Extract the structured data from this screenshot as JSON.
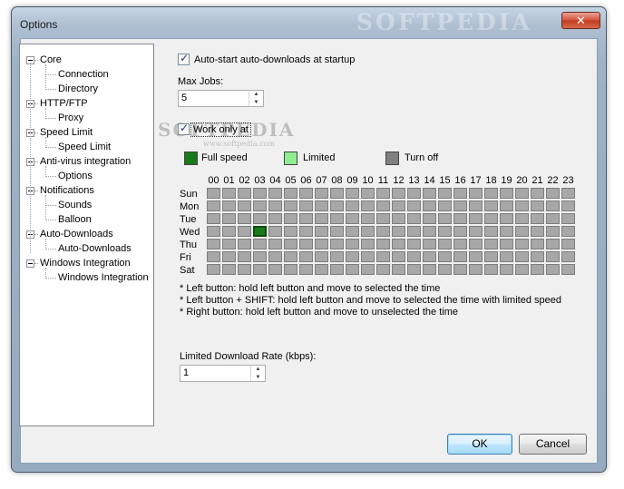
{
  "window": {
    "title": "Options",
    "close_glyph": "✕",
    "watermark": "SOFTPEDIA",
    "faint_watermark": "SOFTPEDIA",
    "faint_watermark_sub": "www.softpedia.com"
  },
  "tree": {
    "groups": [
      {
        "label": "Core",
        "children": [
          "Connection",
          "Directory"
        ]
      },
      {
        "label": "HTTP/FTP",
        "children": [
          "Proxy"
        ]
      },
      {
        "label": "Speed Limit",
        "children": [
          "Speed Limit"
        ]
      },
      {
        "label": "Anti-virus integration",
        "children": [
          "Options"
        ]
      },
      {
        "label": "Notifications",
        "children": [
          "Sounds",
          "Balloon"
        ]
      },
      {
        "label": "Auto-Downloads",
        "children": [
          "Auto-Downloads"
        ]
      },
      {
        "label": "Windows Integration",
        "children": [
          "Windows Integration"
        ]
      }
    ]
  },
  "settings": {
    "auto_start_label": "Auto-start auto-downloads at startup",
    "auto_start_checked": true,
    "max_jobs_label": "Max Jobs:",
    "max_jobs_value": "5",
    "work_only_label": "Work only at",
    "work_only_checked": true
  },
  "legend": {
    "full": {
      "label": "Full speed",
      "color": "#1a7a1a"
    },
    "limited": {
      "label": "Limited",
      "color": "#90ee90"
    },
    "off": {
      "label": "Turn off",
      "color": "#808080"
    }
  },
  "schedule": {
    "hours": [
      "00",
      "01",
      "02",
      "03",
      "04",
      "05",
      "06",
      "07",
      "08",
      "09",
      "10",
      "11",
      "12",
      "13",
      "14",
      "15",
      "16",
      "17",
      "18",
      "19",
      "20",
      "21",
      "22",
      "23"
    ],
    "days": [
      "Sun",
      "Mon",
      "Tue",
      "Wed",
      "Thu",
      "Fri",
      "Sat"
    ],
    "full_speed_cells": [
      {
        "day": "Wed",
        "hour": "03"
      }
    ]
  },
  "help": [
    "* Left button: hold left button and move to selected the time",
    "* Left button + SHIFT: hold left button and move to selected the time with limited speed",
    "* Right button: hold left button and move to unselected the time"
  ],
  "limited_rate": {
    "label": "Limited Download Rate (kbps):",
    "value": "1"
  },
  "buttons": {
    "ok": "OK",
    "cancel": "Cancel"
  }
}
